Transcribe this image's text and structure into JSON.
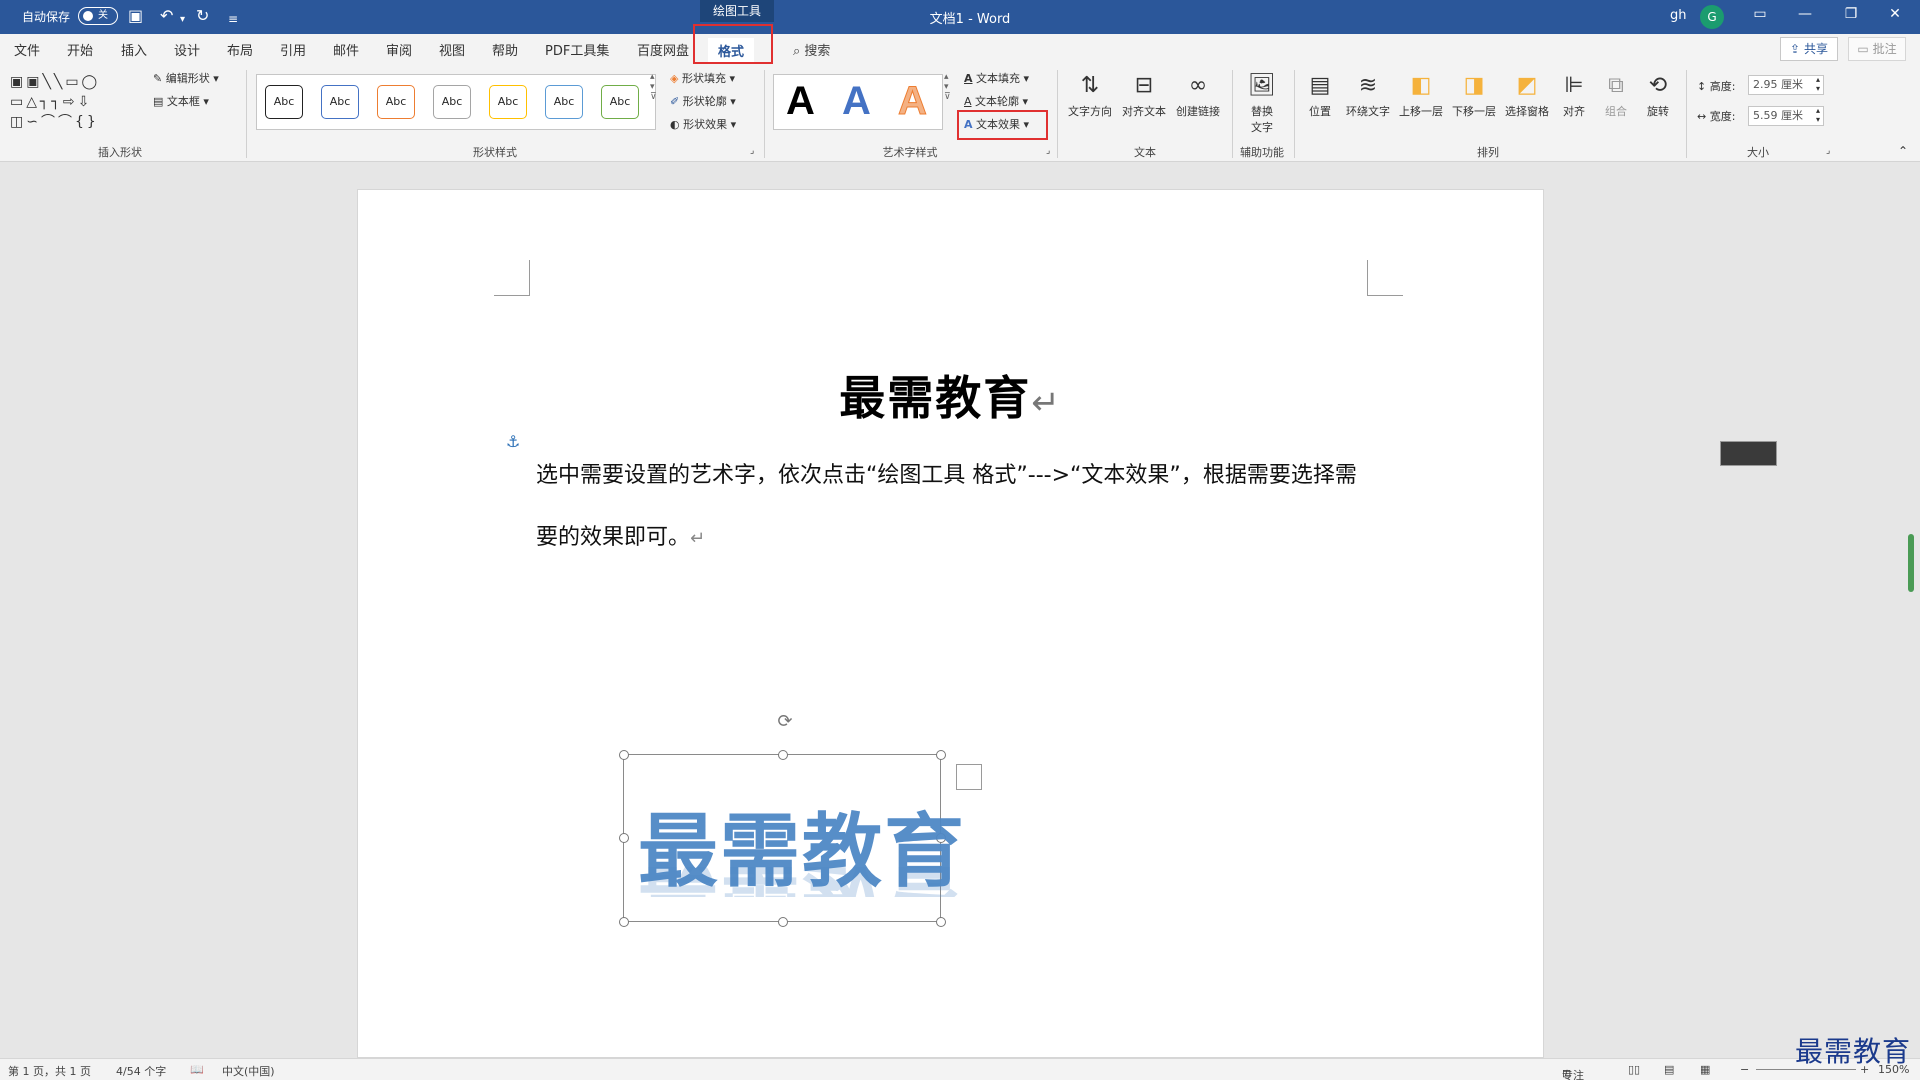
{
  "titlebar": {
    "autosave_label": "自动保存",
    "autosave_state": "关",
    "context_tab": "绘图工具",
    "doc_title": "文档1 - Word",
    "user": "gh",
    "avatar_letter": "G"
  },
  "tabs": [
    "文件",
    "开始",
    "插入",
    "设计",
    "布局",
    "引用",
    "邮件",
    "审阅",
    "视图",
    "帮助",
    "PDF工具集",
    "百度网盘",
    "格式"
  ],
  "active_tab": "格式",
  "search_label": "搜索",
  "share_label": "共享",
  "comment_label": "批注",
  "ribbon": {
    "insert_shapes": {
      "label": "插入形状",
      "edit_shape": "编辑形状",
      "textbox": "文本框"
    },
    "shape_styles": {
      "label": "形状样式",
      "swatch_text": "Abc",
      "fill": "形状填充",
      "outline": "形状轮廓",
      "effects": "形状效果"
    },
    "wordart_styles": {
      "label": "艺术字样式",
      "sample": "A",
      "text_fill": "文本填充",
      "text_outline": "文本轮廓",
      "text_effects": "文本效果"
    },
    "text": {
      "label": "文本",
      "direction": "文字方向",
      "align": "对齐文本",
      "link": "创建链接"
    },
    "accessibility": {
      "label": "辅助功能",
      "alt_text_1": "替换",
      "alt_text_2": "文字"
    },
    "arrange": {
      "label": "排列",
      "position": "位置",
      "wrap": "环绕文字",
      "forward": "上移一层",
      "backward": "下移一层",
      "pane": "选择窗格",
      "align": "对齐",
      "group": "组合",
      "rotate": "旋转"
    },
    "size": {
      "label": "大小",
      "height_label": "高度:",
      "height_value": "2.95 厘米",
      "width_label": "宽度:",
      "width_value": "5.59 厘米"
    }
  },
  "document": {
    "heading": "最需教育",
    "paragraph": "选中需要设置的艺术字，依次点击“绘图工具  格式”--->“文本效果”，根据需要选择需要的效果即可。",
    "wordart": "最需教育"
  },
  "statusbar": {
    "page": "第 1 页，共 1 页",
    "words": "4/54 个字",
    "language": "中文(中国)",
    "focus": "专注",
    "zoom": "150%"
  },
  "watermark": "最需教育",
  "colors": {
    "title_bar": "#2b579a",
    "highlight_box": "#e03030",
    "wordart": "#4f88c6"
  }
}
